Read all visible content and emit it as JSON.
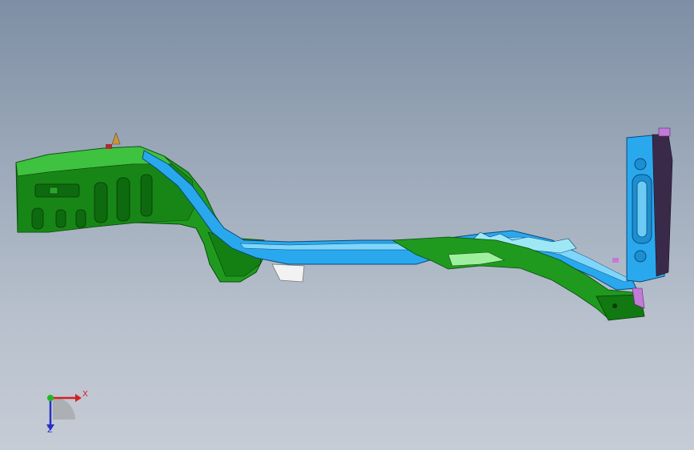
{
  "viewport": {
    "background_top": "#7e8ea4",
    "background_bottom": "#c6ccd6"
  },
  "model": {
    "description_icon": "cad-assembly",
    "colors": {
      "green_part": "#1f9a1f",
      "green_dark": "#0c5a0c",
      "blue_part": "#2aa8ee",
      "blue_light": "#7fd6fa",
      "cyan_part": "#9ee8f6",
      "purple_part": "#c27ad8",
      "white_part": "#f2f2f2"
    }
  },
  "triad": {
    "x_label": "X",
    "z_label": "Z",
    "x_color": "#d42020",
    "y_color": "#22b822",
    "z_color": "#2830c8"
  }
}
